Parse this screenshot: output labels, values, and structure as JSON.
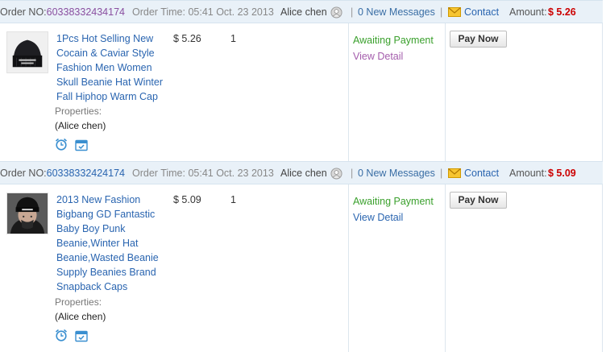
{
  "orders": [
    {
      "order_label": "Order NO:",
      "order_no": "60338332434174",
      "order_time": "Order Time: 05:41 Oct. 23 2013",
      "user": "Alice chen",
      "separator": "|",
      "messages": "0 New Messages",
      "contact": "Contact",
      "amount_label": "Amount:",
      "amount": "$ 5.26",
      "product_title": "1Pcs Hot Selling New Cocain & Caviar Style Fashion Men Women Skull Beanie Hat Winter Fall Hiphop Warm Cap",
      "properties_label": "Properties:",
      "properties_value": "(Alice chen)",
      "price": "$ 5.26",
      "quantity": "1",
      "status": "Awaiting Payment",
      "view_detail": "View Detail",
      "view_detail_color": "#a45dac",
      "pay_button": "Pay Now"
    },
    {
      "order_label": "Order NO:",
      "order_no": "60338332424174",
      "order_time": "Order Time: 05:41 Oct. 23 2013",
      "user": "Alice chen",
      "separator": "|",
      "messages": "0 New Messages",
      "contact": "Contact",
      "amount_label": "Amount:",
      "amount": "$ 5.09",
      "product_title": "2013 New Fashion Bigbang GD Fantastic Baby Boy Punk Beanie,Winter Hat Beanie,Wasted Beanie Supply Beanies Brand Snapback Caps",
      "properties_label": "Properties:",
      "properties_value": "(Alice chen)",
      "price": "$ 5.09",
      "quantity": "1",
      "status": "Awaiting Payment",
      "view_detail": "View Detail",
      "view_detail_color": "#2a65b0",
      "pay_button": "Pay Now"
    }
  ],
  "colors": {
    "header_bg": "#e9f1f8",
    "link_blue": "#2a65b0",
    "order_no_purple": "#8a4fa0",
    "amount_red": "#cc0000",
    "status_green": "#3aa02c"
  },
  "icons": [
    "user-avatar-icon",
    "envelope-icon",
    "alarm-clock-icon",
    "calendar-icon",
    "beanie-product-image",
    "person-product-image"
  ]
}
